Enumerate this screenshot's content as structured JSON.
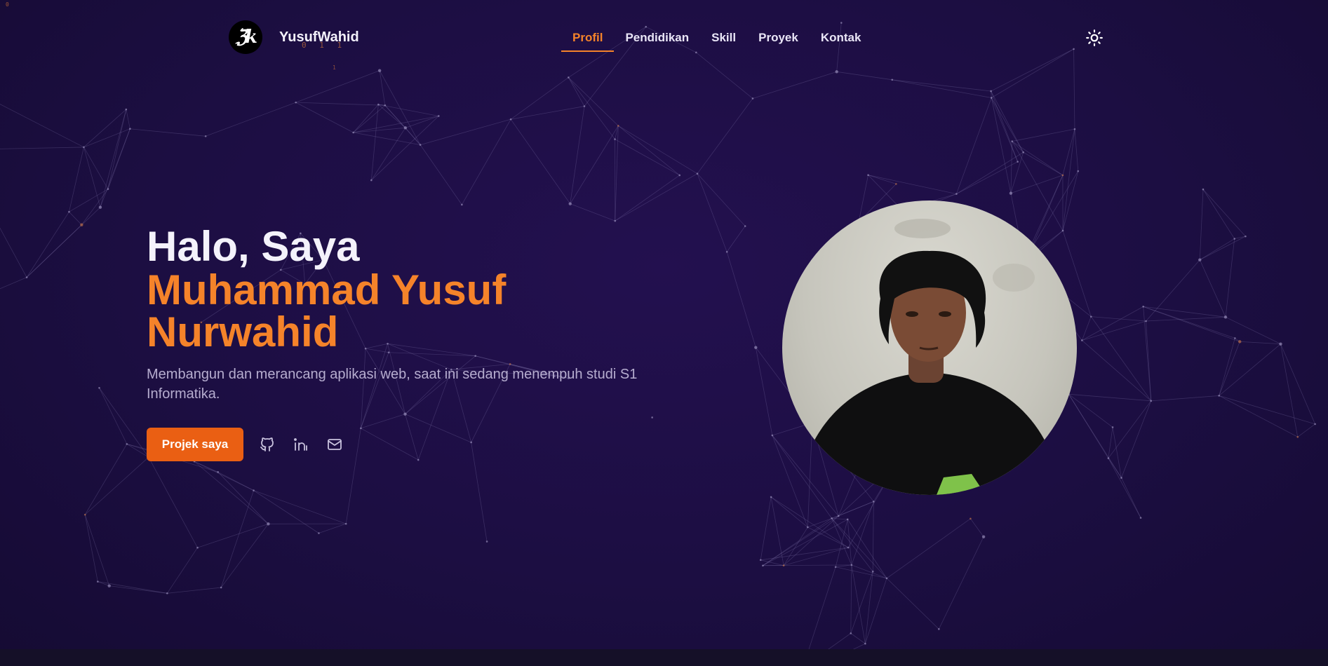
{
  "header": {
    "logo_text": "ℨk",
    "brand": "YusufWahid",
    "binary_a": "0 1 1",
    "binary_b": "1",
    "corner_digit": "0"
  },
  "nav": {
    "items": [
      {
        "label": "Profil",
        "active": true
      },
      {
        "label": "Pendidikan",
        "active": false
      },
      {
        "label": "Skill",
        "active": false
      },
      {
        "label": "Proyek",
        "active": false
      },
      {
        "label": "Kontak",
        "active": false
      }
    ],
    "theme_toggle_icon": "sun-icon"
  },
  "hero": {
    "greeting": "Halo, Saya",
    "name_line1": "Muhammad Yusuf",
    "name_line2": "Nurwahid",
    "description": "Membangun dan merancang aplikasi web, saat ini sedang menempuh studi S1 Informatika.",
    "cta_label": "Projek saya",
    "social_icons": [
      "github-icon",
      "linkedin-icon",
      "mail-icon"
    ]
  },
  "photo": {
    "subject": "profile-photo"
  },
  "colors": {
    "accent": "#f5832a",
    "button": "#ea5f13",
    "background": "#1e0f45",
    "text": "#f4f2fb",
    "muted": "#b6adcf"
  }
}
